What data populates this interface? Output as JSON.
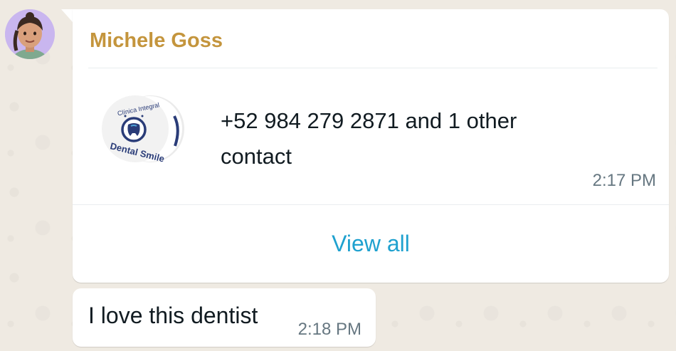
{
  "message": {
    "sender": "Michele Goss",
    "contact_card": {
      "title": "+52 984 279 2871 and 1 other contact",
      "photo_logo_text_top": "Clínica Integral",
      "photo_logo_text_bottom": "Dental Smile",
      "time": "2:17 PM",
      "action_label": "View all"
    }
  },
  "reply": {
    "text": "I love this dentist",
    "time": "2:18 PM"
  },
  "icons": {
    "avatar": "memoji-avatar",
    "contact_photo": "dental-smile-logo"
  },
  "colors": {
    "sender": "#c4953d",
    "link": "#1fa1cf",
    "bubble": "#ffffff",
    "background": "#efeae2"
  }
}
